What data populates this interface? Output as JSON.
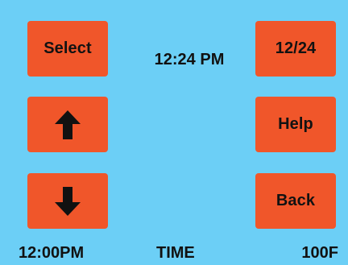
{
  "app": {
    "time": "12:24 PM"
  },
  "buttons": {
    "select": "Select",
    "format_toggle": "12/24",
    "help": "Help",
    "back": "Back",
    "up_icon": "arrow-up",
    "down_icon": "arrow-down"
  },
  "footer": {
    "left": "12:00PM",
    "center": "TIME",
    "right": "100F"
  },
  "colors": {
    "background": "#6CCFF6",
    "button": "#F0562A",
    "text": "#111111"
  }
}
